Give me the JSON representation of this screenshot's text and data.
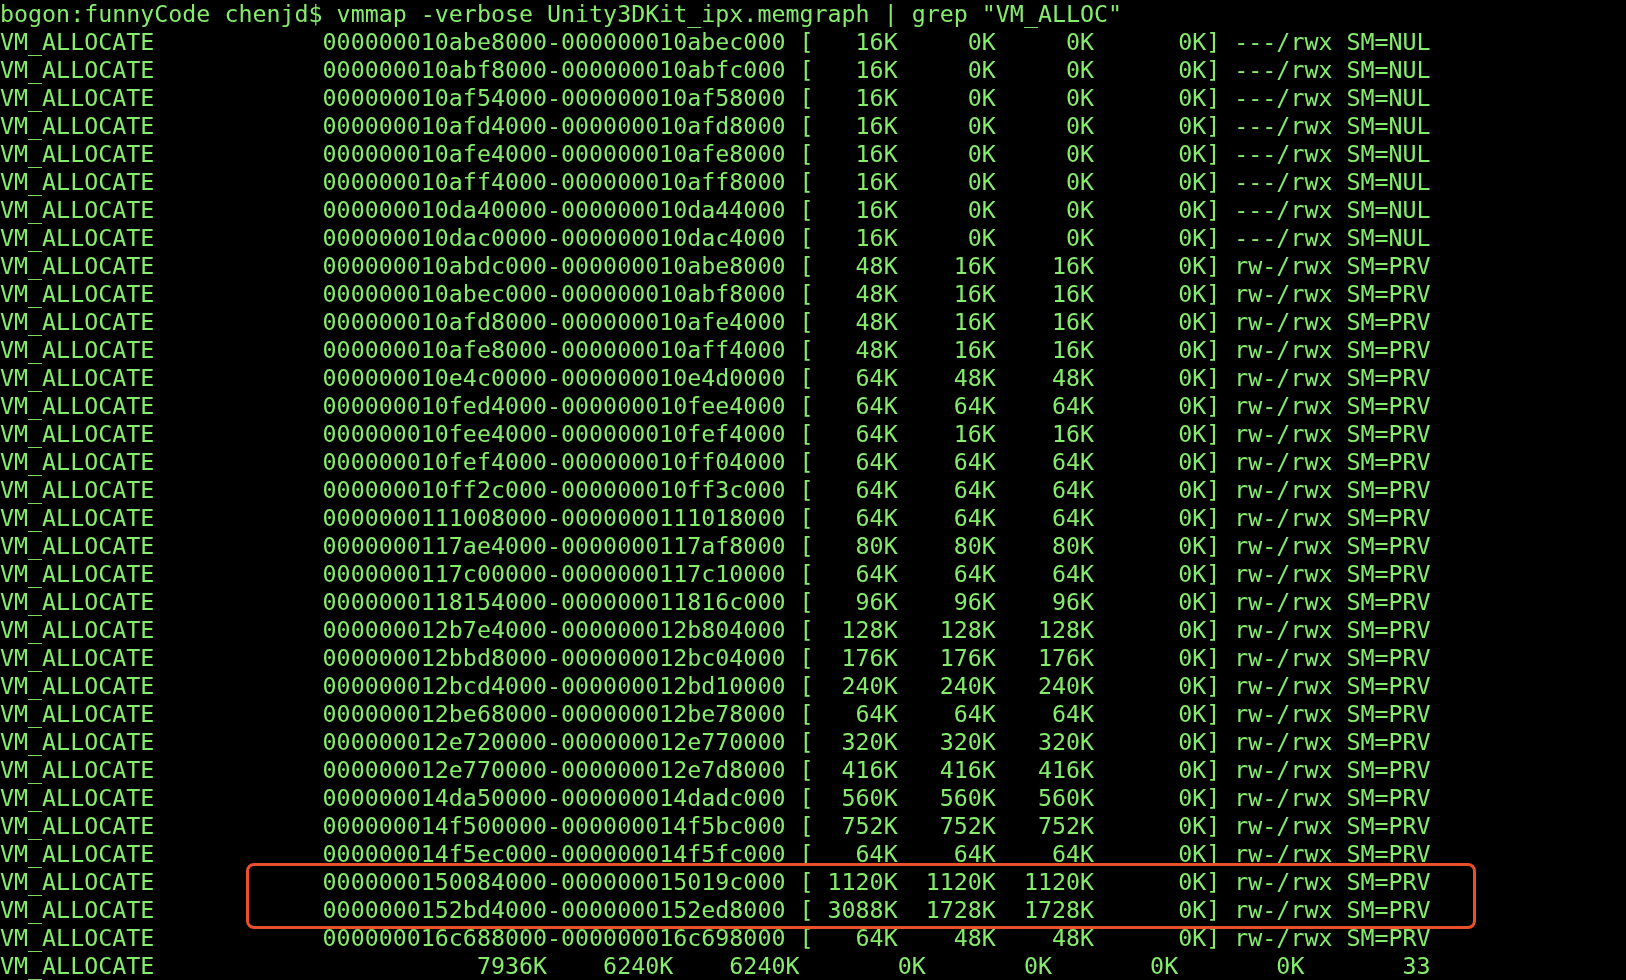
{
  "terminal": {
    "command": "bogon:funnyCode chenjd$ vmmap -verbose Unity3DKit_ipx.memgraph | grep \"VM_ALLOC\"",
    "lines": [
      {
        "text": "VM_ALLOCATE            000000010abe8000-000000010abec000 [   16K     0K     0K      0K] ---/rwx SM=NUL",
        "highlighted": false
      },
      {
        "text": "VM_ALLOCATE            000000010abf8000-000000010abfc000 [   16K     0K     0K      0K] ---/rwx SM=NUL",
        "highlighted": false
      },
      {
        "text": "VM_ALLOCATE            000000010af54000-000000010af58000 [   16K     0K     0K      0K] ---/rwx SM=NUL",
        "highlighted": false
      },
      {
        "text": "VM_ALLOCATE            000000010afd4000-000000010afd8000 [   16K     0K     0K      0K] ---/rwx SM=NUL",
        "highlighted": false
      },
      {
        "text": "VM_ALLOCATE            000000010afe4000-000000010afe8000 [   16K     0K     0K      0K] ---/rwx SM=NUL",
        "highlighted": false
      },
      {
        "text": "VM_ALLOCATE            000000010aff4000-000000010aff8000 [   16K     0K     0K      0K] ---/rwx SM=NUL",
        "highlighted": false
      },
      {
        "text": "VM_ALLOCATE            000000010da40000-000000010da44000 [   16K     0K     0K      0K] ---/rwx SM=NUL",
        "highlighted": false
      },
      {
        "text": "VM_ALLOCATE            000000010dac0000-000000010dac4000 [   16K     0K     0K      0K] ---/rwx SM=NUL",
        "highlighted": false
      },
      {
        "text": "VM_ALLOCATE            000000010abdc000-000000010abe8000 [   48K    16K    16K      0K] rw-/rwx SM=PRV",
        "highlighted": false
      },
      {
        "text": "VM_ALLOCATE            000000010abec000-000000010abf8000 [   48K    16K    16K      0K] rw-/rwx SM=PRV",
        "highlighted": false
      },
      {
        "text": "VM_ALLOCATE            000000010afd8000-000000010afe4000 [   48K    16K    16K      0K] rw-/rwx SM=PRV",
        "highlighted": false
      },
      {
        "text": "VM_ALLOCATE            000000010afe8000-000000010aff4000 [   48K    16K    16K      0K] rw-/rwx SM=PRV",
        "highlighted": false
      },
      {
        "text": "VM_ALLOCATE            000000010e4c0000-000000010e4d0000 [   64K    48K    48K      0K] rw-/rwx SM=PRV",
        "highlighted": false
      },
      {
        "text": "VM_ALLOCATE            000000010fed4000-000000010fee4000 [   64K    64K    64K      0K] rw-/rwx SM=PRV",
        "highlighted": false
      },
      {
        "text": "VM_ALLOCATE            000000010fee4000-000000010fef4000 [   64K    16K    16K      0K] rw-/rwx SM=PRV",
        "highlighted": false
      },
      {
        "text": "VM_ALLOCATE            000000010fef4000-000000010ff04000 [   64K    64K    64K      0K] rw-/rwx SM=PRV",
        "highlighted": false
      },
      {
        "text": "VM_ALLOCATE            000000010ff2c000-000000010ff3c000 [   64K    64K    64K      0K] rw-/rwx SM=PRV",
        "highlighted": false
      },
      {
        "text": "VM_ALLOCATE            0000000111008000-0000000111018000 [   64K    64K    64K      0K] rw-/rwx SM=PRV",
        "highlighted": false
      },
      {
        "text": "VM_ALLOCATE            0000000117ae4000-0000000117af8000 [   80K    80K    80K      0K] rw-/rwx SM=PRV",
        "highlighted": false
      },
      {
        "text": "VM_ALLOCATE            0000000117c00000-0000000117c10000 [   64K    64K    64K      0K] rw-/rwx SM=PRV",
        "highlighted": false
      },
      {
        "text": "VM_ALLOCATE            0000000118154000-000000011816c000 [   96K    96K    96K      0K] rw-/rwx SM=PRV",
        "highlighted": false
      },
      {
        "text": "VM_ALLOCATE            000000012b7e4000-000000012b804000 [  128K   128K   128K      0K] rw-/rwx SM=PRV",
        "highlighted": false
      },
      {
        "text": "VM_ALLOCATE            000000012bbd8000-000000012bc04000 [  176K   176K   176K      0K] rw-/rwx SM=PRV",
        "highlighted": false
      },
      {
        "text": "VM_ALLOCATE            000000012bcd4000-000000012bd10000 [  240K   240K   240K      0K] rw-/rwx SM=PRV",
        "highlighted": false
      },
      {
        "text": "VM_ALLOCATE            000000012be68000-000000012be78000 [   64K    64K    64K      0K] rw-/rwx SM=PRV",
        "highlighted": false
      },
      {
        "text": "VM_ALLOCATE            000000012e720000-000000012e770000 [  320K   320K   320K      0K] rw-/rwx SM=PRV",
        "highlighted": false
      },
      {
        "text": "VM_ALLOCATE            000000012e770000-000000012e7d8000 [  416K   416K   416K      0K] rw-/rwx SM=PRV",
        "highlighted": false
      },
      {
        "text": "VM_ALLOCATE            000000014da50000-000000014dadc000 [  560K   560K   560K      0K] rw-/rwx SM=PRV",
        "highlighted": false
      },
      {
        "text": "VM_ALLOCATE            000000014f500000-000000014f5bc000 [  752K   752K   752K      0K] rw-/rwx SM=PRV",
        "highlighted": false
      },
      {
        "text": "VM_ALLOCATE            000000014f5ec000-000000014f5fc000 [   64K    64K    64K      0K] rw-/rwx SM=PRV",
        "highlighted": false
      },
      {
        "text": "VM_ALLOCATE            0000000150084000-000000015019c000 [ 1120K  1120K  1120K      0K] rw-/rwx SM=PRV",
        "highlighted": true
      },
      {
        "text": "VM_ALLOCATE            0000000152bd4000-0000000152ed8000 [ 3088K  1728K  1728K      0K] rw-/rwx SM=PRV",
        "highlighted": true
      },
      {
        "text": "VM_ALLOCATE            000000016c688000-000000016c698000 [   64K    48K    48K      0K] rw-/rwx SM=PRV",
        "highlighted": false
      },
      {
        "text": "VM_ALLOCATE                       7936K    6240K    6240K       0K       0K       0K       0K       33",
        "highlighted": false
      }
    ]
  }
}
